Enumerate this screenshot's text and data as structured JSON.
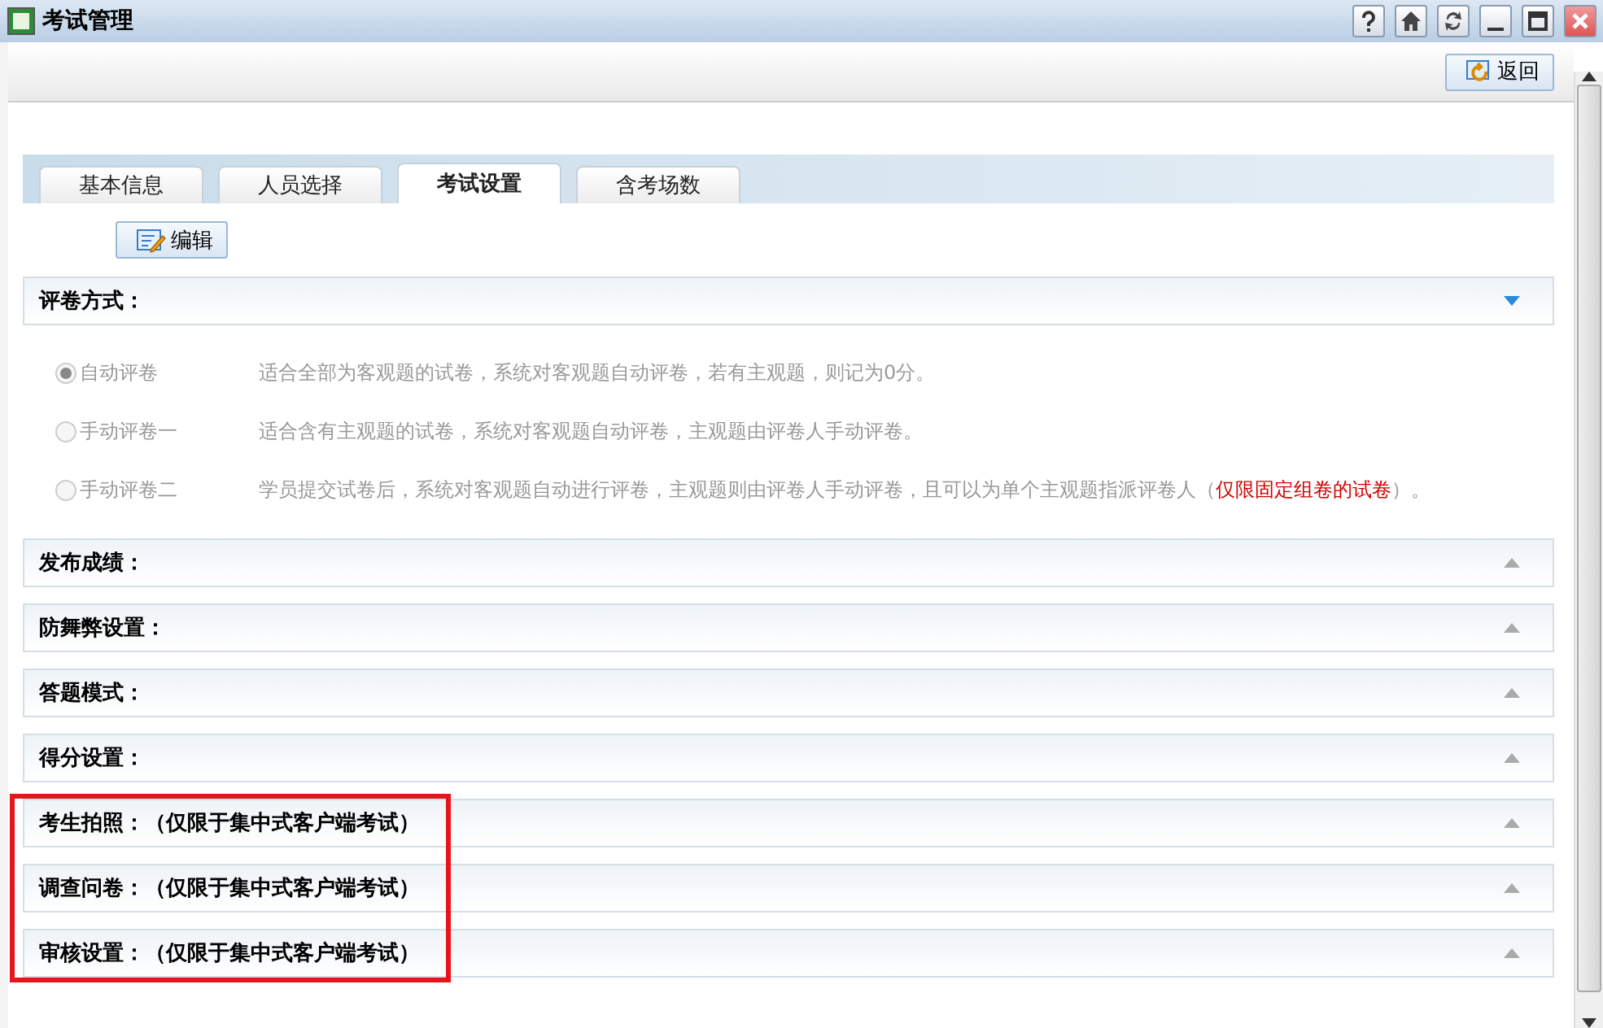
{
  "window": {
    "title": "考试管理"
  },
  "title_buttons": [
    {
      "kind": "help"
    },
    {
      "kind": "home"
    },
    {
      "kind": "refresh"
    },
    {
      "kind": "minimize"
    },
    {
      "kind": "maximize"
    },
    {
      "kind": "close"
    }
  ],
  "toolbar": {
    "back_button": "返回"
  },
  "tabs": [
    {
      "label": "基本信息",
      "selected": false
    },
    {
      "label": "人员选择",
      "selected": false
    },
    {
      "label": "考试设置",
      "selected": true
    },
    {
      "label": "含考场数",
      "selected": false
    }
  ],
  "edit_button": "编辑",
  "sections": [
    {
      "title": "评卷方式：",
      "expanded": true,
      "options": [
        {
          "label": "自动评卷",
          "selected": true,
          "disabled": true,
          "description": "适合全部为客观题的试卷，系统对客观题自动评卷，若有主观题，则记为0分。"
        },
        {
          "label": "手动评卷一",
          "selected": false,
          "disabled": true,
          "description": "适合含有主观题的试卷，系统对客观题自动评卷，主观题由评卷人手动评卷。"
        },
        {
          "label": "手动评卷二",
          "selected": false,
          "disabled": true,
          "description": "学员提交试卷后，系统对客观题自动进行评卷，主观题则由评卷人手动评卷，且可以为单个主观题指派评卷人（",
          "highlight": "仅限固定组卷的试卷",
          "suffix": "）。"
        }
      ]
    },
    {
      "title": "发布成绩：",
      "expanded": false
    },
    {
      "title": "防舞弊设置：",
      "expanded": false
    },
    {
      "title": "答题模式：",
      "expanded": false
    },
    {
      "title": "得分设置：",
      "expanded": false
    }
  ],
  "highlighted_sections": [
    {
      "title": "考生拍照：（仅限于集中式客户端考试）",
      "expanded": false
    },
    {
      "title": "调查问卷：（仅限于集中式客户端考试）",
      "expanded": false
    },
    {
      "title": "审核设置：（仅限于集中式客户端考试）",
      "expanded": false
    }
  ]
}
